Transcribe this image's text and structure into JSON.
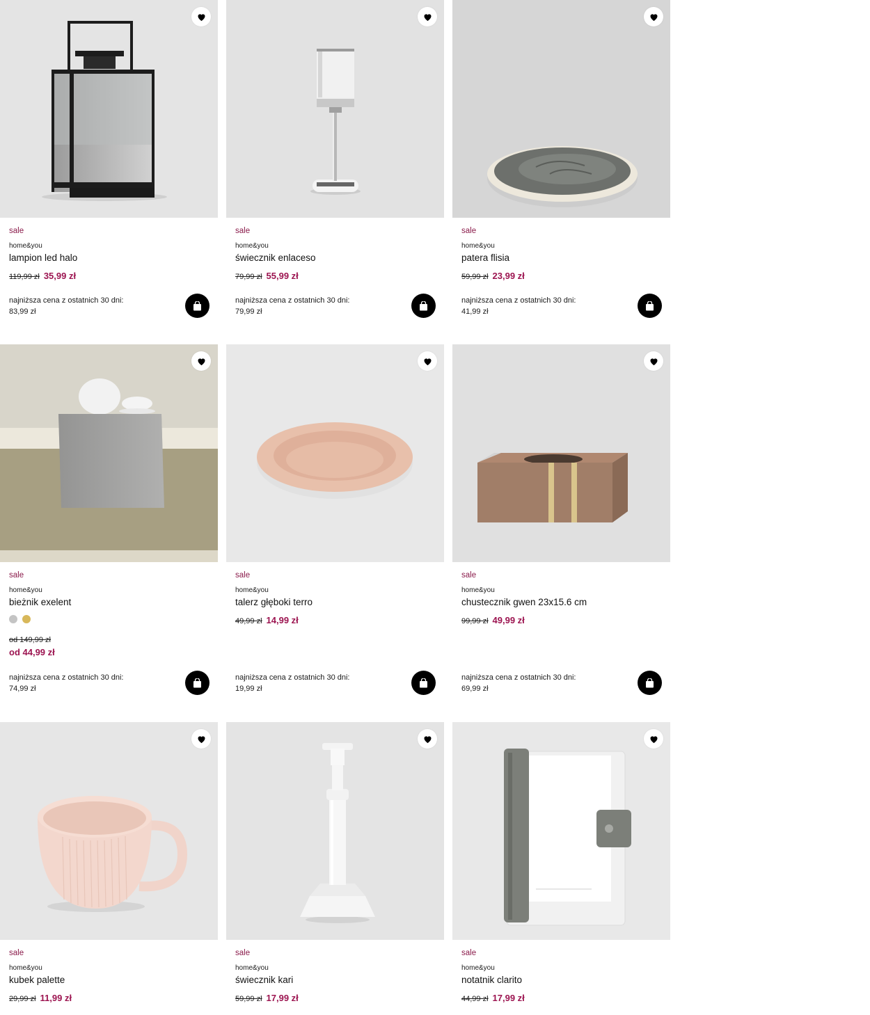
{
  "labels": {
    "sale": "sale",
    "brand": "home&you",
    "lowest_price_label": "najniższa cena z ostatnich 30 dni:"
  },
  "colors": {
    "sale_accent": "#9c1450",
    "button_bg": "#000000"
  },
  "icons": {
    "favorite": "heart-icon",
    "add_to_cart": "shopping-bag-icon"
  },
  "products": [
    {
      "name": "lampion led halo",
      "old_price": "119,99 zł",
      "new_price": "35,99 zł",
      "lowest_price": "83,99 zł"
    },
    {
      "name": "świecznik enlaceso",
      "old_price": "79,99 zł",
      "new_price": "55,99 zł",
      "lowest_price": "79,99 zł"
    },
    {
      "name": "patera flisia",
      "old_price": "59,99 zł",
      "new_price": "23,99 zł",
      "lowest_price": "41,99 zł"
    },
    {
      "name": "bieżnik exelent",
      "old_price": "od 149,99 zł",
      "new_price": "od 44,99 zł",
      "lowest_price": "74,99 zł",
      "swatch_colors": [
        "#c4c4c4",
        "#d8b85a"
      ]
    },
    {
      "name": "talerz głęboki terro",
      "old_price": "49,99 zł",
      "new_price": "14,99 zł",
      "lowest_price": "19,99 zł"
    },
    {
      "name": "chustecznik gwen 23x15.6 cm",
      "old_price": "99,99 zł",
      "new_price": "49,99 zł",
      "lowest_price": "69,99 zł"
    },
    {
      "name": "kubek palette",
      "old_price": "29,99 zł",
      "new_price": "11,99 zł"
    },
    {
      "name": "świecznik kari",
      "old_price": "59,99 zł",
      "new_price": "17,99 zł"
    },
    {
      "name": "notatnik clarito",
      "old_price": "44,99 zł",
      "new_price": "17,99 zł"
    }
  ]
}
